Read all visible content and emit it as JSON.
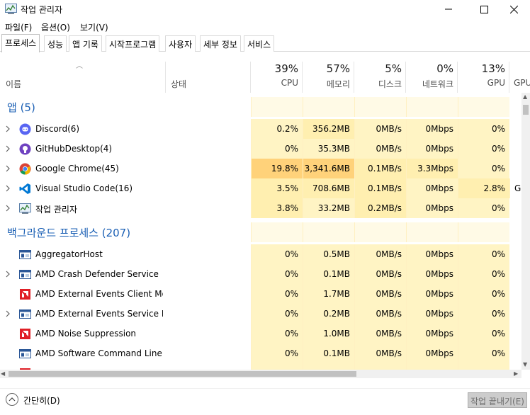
{
  "window": {
    "title": "작업 관리자"
  },
  "menu": [
    "파일(F)",
    "옵션(O)",
    "보기(V)"
  ],
  "tabs": [
    "프로세스",
    "성능",
    "앱 기록",
    "시작프로그램",
    "사용자",
    "세부 정보",
    "서비스"
  ],
  "header": {
    "name": "이름",
    "status": "상태",
    "columns": [
      {
        "pct": "39%",
        "label": "CPU"
      },
      {
        "pct": "57%",
        "label": "메모리"
      },
      {
        "pct": "5%",
        "label": "디스크"
      },
      {
        "pct": "0%",
        "label": "네트워크"
      },
      {
        "pct": "13%",
        "label": "GPU"
      },
      {
        "pct": "",
        "label": "GPU"
      }
    ]
  },
  "groups": {
    "apps": "앱 (5)",
    "background": "백그라운드 프로세스 (207)"
  },
  "apps": [
    {
      "name": "Discord(6)",
      "icon": "discord-icon",
      "cpu": "0.2%",
      "mem": "356.2MB",
      "disk": "0MB/s",
      "net": "0Mbps",
      "gpu": "0%",
      "gpueng": ""
    },
    {
      "name": "GitHubDesktop(4)",
      "icon": "github-desktop-icon",
      "cpu": "0%",
      "mem": "35.3MB",
      "disk": "0MB/s",
      "net": "0Mbps",
      "gpu": "0%",
      "gpueng": ""
    },
    {
      "name": "Google Chrome(45)",
      "icon": "chrome-icon",
      "cpu": "19.8%",
      "mem": "3,341.6MB",
      "disk": "0.1MB/s",
      "net": "3.3Mbps",
      "gpu": "0%",
      "gpueng": ""
    },
    {
      "name": "Visual Studio Code(16)",
      "icon": "vscode-icon",
      "cpu": "3.5%",
      "mem": "708.6MB",
      "disk": "0.1MB/s",
      "net": "0Mbps",
      "gpu": "2.8%",
      "gpueng": "GI"
    },
    {
      "name": "작업 관리자",
      "icon": "task-manager-icon",
      "cpu": "3.8%",
      "mem": "33.2MB",
      "disk": "0.2MB/s",
      "net": "0Mbps",
      "gpu": "0%",
      "gpueng": ""
    }
  ],
  "background": [
    {
      "name": "AggregatorHost",
      "icon": "service-window-icon",
      "expand": false,
      "cpu": "0%",
      "mem": "0.5MB",
      "disk": "0MB/s",
      "net": "0Mbps",
      "gpu": "0%"
    },
    {
      "name": "AMD Crash Defender Service",
      "icon": "service-window-icon",
      "expand": true,
      "cpu": "0%",
      "mem": "0.1MB",
      "disk": "0MB/s",
      "net": "0Mbps",
      "gpu": "0%"
    },
    {
      "name": "AMD External Events Client Mo...",
      "icon": "amd-icon",
      "expand": false,
      "cpu": "0%",
      "mem": "1.7MB",
      "disk": "0MB/s",
      "net": "0Mbps",
      "gpu": "0%"
    },
    {
      "name": "AMD External Events Service M...",
      "icon": "service-window-icon",
      "expand": true,
      "cpu": "0%",
      "mem": "0.2MB",
      "disk": "0MB/s",
      "net": "0Mbps",
      "gpu": "0%"
    },
    {
      "name": "AMD Noise Suppression",
      "icon": "amd-icon",
      "expand": false,
      "cpu": "0%",
      "mem": "1.0MB",
      "disk": "0MB/s",
      "net": "0Mbps",
      "gpu": "0%"
    },
    {
      "name": "AMD Software Command Line...",
      "icon": "service-window-icon",
      "expand": false,
      "cpu": "0%",
      "mem": "0.1MB",
      "disk": "0MB/s",
      "net": "0Mbps",
      "gpu": "0%"
    }
  ],
  "footer": {
    "collapse": "간단히(D)",
    "end_task": "작업 끝내기(E)"
  },
  "colors": {
    "accent": "#1a5fb4",
    "heat_low": "#fff4c4",
    "heat_mid": "#ffefb0",
    "heat_high": "#ffd27a"
  }
}
